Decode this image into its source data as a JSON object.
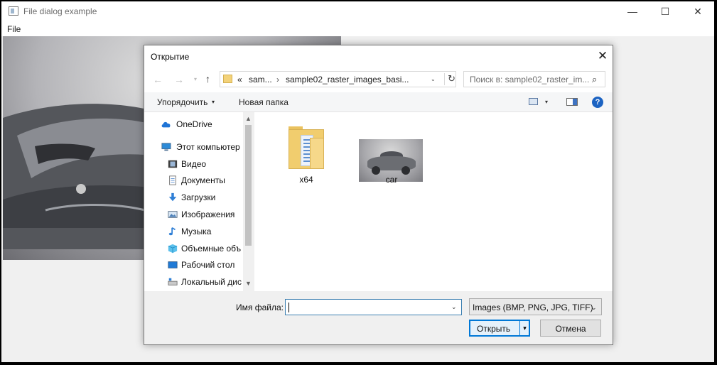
{
  "app": {
    "title": "File dialog example",
    "controls": {
      "minimize": "—",
      "maximize": "☐",
      "close": "✕"
    },
    "menu": [
      "File"
    ]
  },
  "dialog": {
    "title": "Открытие",
    "close": "✕",
    "nav": {
      "back": "←",
      "forward": "→",
      "recent": "▾",
      "up": "↑"
    },
    "address": {
      "prefix": "«",
      "segments": [
        "sam...",
        "sample02_raster_images_basi..."
      ],
      "separator": "›",
      "dropdown": "⌄",
      "refresh": "↻"
    },
    "search": {
      "placeholder": "Поиск в: sample02_raster_im...",
      "icon": "⌕"
    },
    "toolbar": {
      "organize": "Упорядочить",
      "organize_arrow": "▾",
      "new_folder": "Новая папка",
      "view_arrow": "▾",
      "help": "?"
    },
    "nav_pane": {
      "items": [
        {
          "label": "OneDrive",
          "icon": "cloud-icon"
        },
        {
          "label": "Этот компьютер",
          "icon": "computer-icon"
        },
        {
          "label": "Видео",
          "icon": "video-icon"
        },
        {
          "label": "Документы",
          "icon": "document-icon"
        },
        {
          "label": "Загрузки",
          "icon": "download-icon"
        },
        {
          "label": "Изображения",
          "icon": "pictures-icon"
        },
        {
          "label": "Музыка",
          "icon": "music-icon"
        },
        {
          "label": "Объемные объ",
          "icon": "3d-objects-icon"
        },
        {
          "label": "Рабочий стол",
          "icon": "desktop-icon"
        },
        {
          "label": "Локальный дис",
          "icon": "drive-icon"
        }
      ],
      "scroll_up": "▲",
      "scroll_down": "▼"
    },
    "files": [
      {
        "name": "x64",
        "type": "folder"
      },
      {
        "name": "car",
        "type": "image"
      }
    ],
    "bottom": {
      "file_name_label": "Имя файла:",
      "file_name_value": "",
      "file_name_dropdown": "⌄",
      "filter": "Images (BMP, PNG, JPG, TIFF)",
      "filter_dropdown": "⌄",
      "open": "Открыть",
      "open_split": "▾",
      "cancel": "Отмена"
    }
  },
  "colors": {
    "accent": "#0078d7",
    "help": "#1c63c2",
    "folder": "#f1cd6e"
  }
}
